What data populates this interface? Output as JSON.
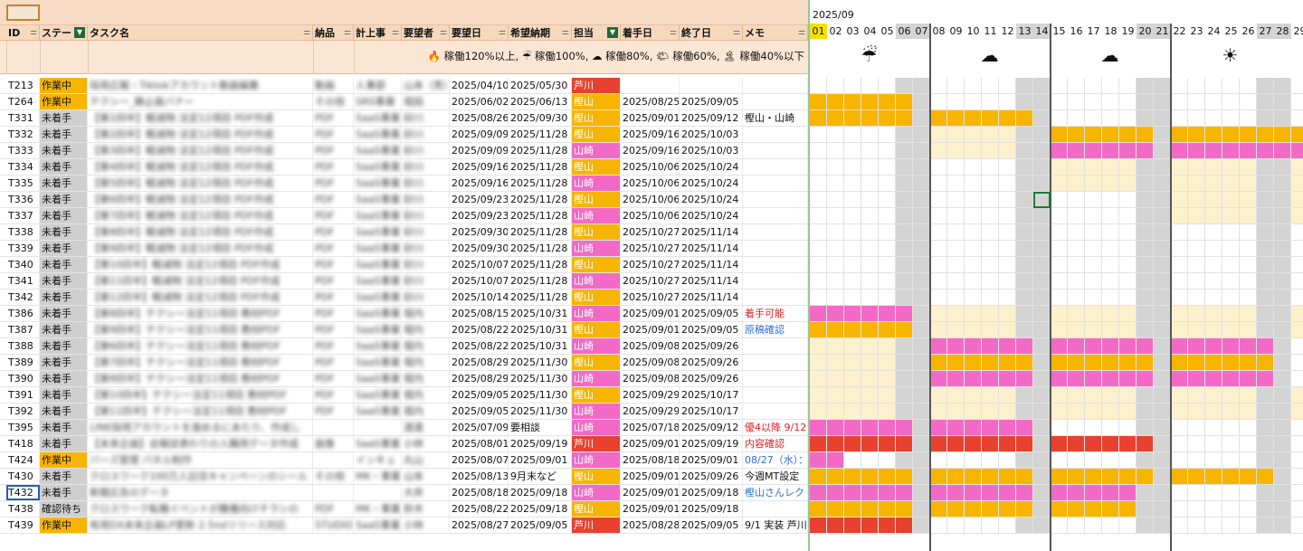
{
  "columns": [
    {
      "key": "id",
      "label": "ID",
      "filter": "plain"
    },
    {
      "key": "status",
      "label": "ステー",
      "filter": "active"
    },
    {
      "key": "task",
      "label": "タスク名",
      "filter": "plain"
    },
    {
      "key": "deliv",
      "label": "納品",
      "filter": "plain"
    },
    {
      "key": "acct",
      "label": "計上事",
      "filter": "plain"
    },
    {
      "key": "req",
      "label": "要望者",
      "filter": "plain"
    },
    {
      "key": "reqdate",
      "label": "要望日",
      "filter": "plain"
    },
    {
      "key": "due",
      "label": "希望納期",
      "filter": "plain"
    },
    {
      "key": "owner",
      "label": "担当",
      "filter": "active"
    },
    {
      "key": "start",
      "label": "着手日",
      "filter": "plain"
    },
    {
      "key": "end",
      "label": "終了日",
      "filter": "plain"
    },
    {
      "key": "memo",
      "label": "メモ",
      "filter": "plain"
    }
  ],
  "legend": "🔥 稼働120%以上, ☔ 稼働100%, ☁ 稼働80%, 🌤 稼働60%, 🏝 稼働40%以下",
  "gantt": {
    "month": "2025/09",
    "days": [
      "01",
      "02",
      "03",
      "04",
      "05",
      "06",
      "07",
      "08",
      "09",
      "10",
      "11",
      "12",
      "13",
      "14",
      "15",
      "16",
      "17",
      "18",
      "19",
      "20",
      "21",
      "22",
      "23",
      "24",
      "25",
      "26",
      "27",
      "28",
      "29"
    ],
    "weekends": [
      "06",
      "07",
      "13",
      "14",
      "20",
      "21",
      "27",
      "28"
    ],
    "today": "01",
    "weather": [
      "☔",
      "☁",
      "☁",
      "☀"
    ]
  },
  "colors": {
    "orange": "#f7b500",
    "pink": "#f36ac6",
    "red": "#e8412f",
    "light": "#fdf0cc",
    "weekend": "#d4d4d4"
  },
  "rows": [
    {
      "id": "T213",
      "status": "作業中",
      "task": "採用広報・Tiktokアカウント動画編集",
      "deliv": "動画",
      "acct": "人事部",
      "req": "山本（秀）",
      "reqdate": "2025/04/10",
      "due": "2025/05/30",
      "owner": "芦川",
      "start": "",
      "end": "",
      "memo": "",
      "memo_color": ""
    },
    {
      "id": "T264",
      "status": "作業中",
      "task": "テクシー_静止画バナー",
      "deliv": "その他",
      "acct": "SRS事業",
      "req": "堀田",
      "reqdate": "2025/06/02",
      "due": "2025/06/13",
      "owner": "樫山",
      "start": "2025/08/25",
      "end": "2025/09/05",
      "memo": "",
      "memo_color": ""
    },
    {
      "id": "T331",
      "status": "未着手",
      "task": "【第1四半】軽減物 法定12項目 PDF作成",
      "deliv": "PDF",
      "acct": "SaaS事業",
      "req": "砂川",
      "reqdate": "2025/08/26",
      "due": "2025/09/30",
      "owner": "樫山",
      "start": "2025/09/01",
      "end": "2025/09/12",
      "memo": "樫山・山崎",
      "memo_color": ""
    },
    {
      "id": "T332",
      "status": "未着手",
      "task": "【第2四半】軽減物 法定12項目 PDF作成",
      "deliv": "PDF",
      "acct": "SaaS事業",
      "req": "砂川",
      "reqdate": "2025/09/09",
      "due": "2025/11/28",
      "owner": "樫山",
      "start": "2025/09/16",
      "end": "2025/10/03",
      "memo": "",
      "memo_color": ""
    },
    {
      "id": "T333",
      "status": "未着手",
      "task": "【第3四半】軽減物 法定12項目 PDF作成",
      "deliv": "PDF",
      "acct": "SaaS事業",
      "req": "砂川",
      "reqdate": "2025/09/09",
      "due": "2025/11/28",
      "owner": "山崎",
      "start": "2025/09/16",
      "end": "2025/10/03",
      "memo": "",
      "memo_color": ""
    },
    {
      "id": "T334",
      "status": "未着手",
      "task": "【第4四半】軽減物 法定12項目 PDF作成",
      "deliv": "PDF",
      "acct": "SaaS事業",
      "req": "砂川",
      "reqdate": "2025/09/16",
      "due": "2025/11/28",
      "owner": "樫山",
      "start": "2025/10/06",
      "end": "2025/10/24",
      "memo": "",
      "memo_color": ""
    },
    {
      "id": "T335",
      "status": "未着手",
      "task": "【第5四半】軽減物 法定12項目 PDF作成",
      "deliv": "PDF",
      "acct": "SaaS事業",
      "req": "砂川",
      "reqdate": "2025/09/16",
      "due": "2025/11/28",
      "owner": "山崎",
      "start": "2025/10/06",
      "end": "2025/10/24",
      "memo": "",
      "memo_color": ""
    },
    {
      "id": "T336",
      "status": "未着手",
      "task": "【第6四半】軽減物 法定12項目 PDF作成",
      "deliv": "PDF",
      "acct": "SaaS事業",
      "req": "砂川",
      "reqdate": "2025/09/23",
      "due": "2025/11/28",
      "owner": "樫山",
      "start": "2025/10/06",
      "end": "2025/10/24",
      "memo": "",
      "memo_color": ""
    },
    {
      "id": "T337",
      "status": "未着手",
      "task": "【第7四半】軽減物 法定12項目 PDF作成",
      "deliv": "PDF",
      "acct": "SaaS事業",
      "req": "砂川",
      "reqdate": "2025/09/23",
      "due": "2025/11/28",
      "owner": "山崎",
      "start": "2025/10/06",
      "end": "2025/10/24",
      "memo": "",
      "memo_color": ""
    },
    {
      "id": "T338",
      "status": "未着手",
      "task": "【第8四半】軽減物 法定12項目 PDF作成",
      "deliv": "PDF",
      "acct": "SaaS事業",
      "req": "砂川",
      "reqdate": "2025/09/30",
      "due": "2025/11/28",
      "owner": "樫山",
      "start": "2025/10/27",
      "end": "2025/11/14",
      "memo": "",
      "memo_color": ""
    },
    {
      "id": "T339",
      "status": "未着手",
      "task": "【第9四半】軽減物 法定12項目 PDF作成",
      "deliv": "PDF",
      "acct": "SaaS事業",
      "req": "砂川",
      "reqdate": "2025/09/30",
      "due": "2025/11/28",
      "owner": "山崎",
      "start": "2025/10/27",
      "end": "2025/11/14",
      "memo": "",
      "memo_color": ""
    },
    {
      "id": "T340",
      "status": "未着手",
      "task": "【第10四半】軽減物 法定12項目 PDF作成",
      "deliv": "PDF",
      "acct": "SaaS事業",
      "req": "砂川",
      "reqdate": "2025/10/07",
      "due": "2025/11/28",
      "owner": "樫山",
      "start": "2025/10/27",
      "end": "2025/11/14",
      "memo": "",
      "memo_color": ""
    },
    {
      "id": "T341",
      "status": "未着手",
      "task": "【第11四半】軽減物 法定12項目 PDF作成",
      "deliv": "PDF",
      "acct": "SaaS事業",
      "req": "砂川",
      "reqdate": "2025/10/07",
      "due": "2025/11/28",
      "owner": "山崎",
      "start": "2025/10/27",
      "end": "2025/11/14",
      "memo": "",
      "memo_color": ""
    },
    {
      "id": "T342",
      "status": "未着手",
      "task": "【第12四半】軽減物 法定12項目 PDF作成",
      "deliv": "PDF",
      "acct": "SaaS事業",
      "req": "砂川",
      "reqdate": "2025/10/14",
      "due": "2025/11/28",
      "owner": "樫山",
      "start": "2025/10/27",
      "end": "2025/11/14",
      "memo": "",
      "memo_color": ""
    },
    {
      "id": "T386",
      "status": "未着手",
      "task": "【第8四半】テクシー法定11項目 教材PDF",
      "deliv": "PDF",
      "acct": "SaaS事業",
      "req": "堀内",
      "reqdate": "2025/08/15",
      "due": "2025/10/31",
      "owner": "山崎",
      "start": "2025/09/01",
      "end": "2025/09/05",
      "memo": "着手可能",
      "memo_color": "#e02020"
    },
    {
      "id": "T387",
      "status": "未着手",
      "task": "【第9四半】テクシー法定11項目 教材PDF",
      "deliv": "PDF",
      "acct": "SaaS事業",
      "req": "堀内",
      "reqdate": "2025/08/22",
      "due": "2025/10/31",
      "owner": "樫山",
      "start": "2025/09/01",
      "end": "2025/09/05",
      "memo": "原稿確認",
      "memo_color": "#2f6fd8"
    },
    {
      "id": "T388",
      "status": "未着手",
      "task": "【第6四半】テクシー法定11項目 教材PDF",
      "deliv": "PDF",
      "acct": "SaaS事業",
      "req": "堀内",
      "reqdate": "2025/08/22",
      "due": "2025/10/31",
      "owner": "山崎",
      "start": "2025/09/08",
      "end": "2025/09/26",
      "memo": "",
      "memo_color": ""
    },
    {
      "id": "T389",
      "status": "未着手",
      "task": "【第7四半】テクシー法定11項目 教材PDF",
      "deliv": "PDF",
      "acct": "SaaS事業",
      "req": "堀内",
      "reqdate": "2025/08/29",
      "due": "2025/11/30",
      "owner": "樫山",
      "start": "2025/09/08",
      "end": "2025/09/26",
      "memo": "",
      "memo_color": ""
    },
    {
      "id": "T390",
      "status": "未着手",
      "task": "【第8四半】テクシー法定11項目 教材PDF",
      "deliv": "PDF",
      "acct": "SaaS事業",
      "req": "堀内",
      "reqdate": "2025/08/29",
      "due": "2025/11/30",
      "owner": "山崎",
      "start": "2025/09/08",
      "end": "2025/09/26",
      "memo": "",
      "memo_color": ""
    },
    {
      "id": "T391",
      "status": "未着手",
      "task": "【第10四半】テクシー法定11項目 教材PDF",
      "deliv": "PDF",
      "acct": "SaaS事業",
      "req": "堀内",
      "reqdate": "2025/09/05",
      "due": "2025/11/30",
      "owner": "樫山",
      "start": "2025/09/29",
      "end": "2025/10/17",
      "memo": "",
      "memo_color": ""
    },
    {
      "id": "T392",
      "status": "未着手",
      "task": "【第11四半】テクシー法定11項目 教材PDF",
      "deliv": "PDF",
      "acct": "SaaS事業",
      "req": "堀内",
      "reqdate": "2025/09/05",
      "due": "2025/11/30",
      "owner": "山崎",
      "start": "2025/09/29",
      "end": "2025/10/17",
      "memo": "",
      "memo_color": ""
    },
    {
      "id": "T395",
      "status": "未着手",
      "task": "LINE採用アカウントを進めるにあたり、作成し",
      "deliv": "",
      "acct": "",
      "req": "渡邊",
      "reqdate": "2025/07/09",
      "due": "要相談",
      "owner": "山崎",
      "start": "2025/07/18",
      "end": "2025/09/12",
      "memo": "優4以降 9/12",
      "memo_color": "#e02020"
    },
    {
      "id": "T418",
      "status": "未着手",
      "task": "【未来企画】会報誌表わりの入職用データ作成",
      "deliv": "画像",
      "acct": "SaaS事業",
      "req": "小林",
      "reqdate": "2025/08/01",
      "due": "2025/09/19",
      "owner": "芦川",
      "start": "2025/09/01",
      "end": "2025/09/19",
      "memo": "内容確認",
      "memo_color": "#e02020"
    },
    {
      "id": "T424",
      "status": "作業中",
      "task": "バーズ管理 パネル制作",
      "deliv": "",
      "acct": "インキュ",
      "req": "丸山",
      "reqdate": "2025/08/07",
      "due": "2025/09/01",
      "owner": "山崎",
      "start": "2025/08/18",
      "end": "2025/09/01",
      "memo": "08/27（水）：",
      "memo_color": "#2f6fd8"
    },
    {
      "id": "T430",
      "status": "未着手",
      "task": "クロスワーク100万人記念キャンペーンのシール",
      "deliv": "その他",
      "acct": "MK・事業",
      "req": "山本",
      "reqdate": "2025/08/13",
      "due": "9月末など",
      "owner": "樫山",
      "start": "2025/09/01",
      "end": "2025/09/26",
      "memo": "今週MT設定",
      "memo_color": "#111111"
    },
    {
      "id": "T432",
      "status": "未着手",
      "task": "新聞広告のデータ",
      "deliv": "",
      "acct": "",
      "req": "大井",
      "reqdate": "2025/08/18",
      "due": "2025/09/18",
      "owner": "山崎",
      "start": "2025/09/01",
      "end": "2025/09/18",
      "memo": "樫山さんレク",
      "memo_color": "#2f6fd8"
    },
    {
      "id": "T438",
      "status": "確認待ち",
      "task": "クロスワーク転職イベントが難儀向けチラシの",
      "deliv": "PDF",
      "acct": "MK・事業",
      "req": "鈴木",
      "reqdate": "2025/08/22",
      "due": "2025/09/18",
      "owner": "樫山",
      "start": "2025/09/01",
      "end": "2025/09/18",
      "memo": "",
      "memo_color": ""
    },
    {
      "id": "T439",
      "status": "作業中",
      "task": "有用DX未来企画LP更新 2.5ndリリース対応",
      "deliv": "STUDIO",
      "acct": "SaaS事業",
      "req": "小林",
      "reqdate": "2025/08/27",
      "due": "2025/09/05",
      "owner": "芦川",
      "start": "2025/08/28",
      "end": "2025/09/05",
      "memo": "9/1 実装 芦川",
      "memo_color": "#111111"
    }
  ],
  "bars": [
    [],
    [
      [
        "o",
        0,
        5
      ]
    ],
    [
      [
        "o",
        0,
        5
      ],
      [
        "o",
        7,
        12
      ]
    ],
    [
      [
        "l",
        7,
        12
      ],
      [
        "l",
        14,
        28
      ],
      [
        "o",
        14,
        19
      ],
      [
        "o",
        21,
        28
      ]
    ],
    [
      [
        "l",
        7,
        12
      ],
      [
        "p",
        14,
        19
      ],
      [
        "p",
        21,
        28
      ]
    ],
    [
      [
        "l",
        14,
        28
      ]
    ],
    [
      [
        "l",
        14,
        28
      ]
    ],
    [
      [
        "l",
        21,
        28
      ]
    ],
    [
      [
        "l",
        21,
        28
      ]
    ],
    [],
    [],
    [],
    [],
    [],
    [
      [
        "p",
        0,
        5
      ],
      [
        "l",
        7,
        28
      ]
    ],
    [
      [
        "o",
        0,
        5
      ],
      [
        "l",
        7,
        28
      ]
    ],
    [
      [
        "l",
        0,
        5
      ],
      [
        "p",
        7,
        12
      ],
      [
        "p",
        14,
        19
      ],
      [
        "p",
        21,
        26
      ]
    ],
    [
      [
        "l",
        0,
        5
      ],
      [
        "o",
        7,
        12
      ],
      [
        "o",
        14,
        19
      ],
      [
        "o",
        21,
        26
      ]
    ],
    [
      [
        "l",
        0,
        5
      ],
      [
        "p",
        7,
        12
      ],
      [
        "p",
        14,
        19
      ],
      [
        "p",
        21,
        26
      ]
    ],
    [
      [
        "l",
        0,
        4
      ],
      [
        "l",
        7,
        12
      ],
      [
        "l",
        14,
        19
      ],
      [
        "l",
        21,
        28
      ]
    ],
    [
      [
        "l",
        0,
        4
      ],
      [
        "l",
        7,
        12
      ],
      [
        "l",
        14,
        19
      ],
      [
        "l",
        21,
        28
      ]
    ],
    [
      [
        "p",
        0,
        5
      ],
      [
        "p",
        7,
        12
      ]
    ],
    [
      [
        "r",
        0,
        5
      ],
      [
        "r",
        7,
        12
      ],
      [
        "r",
        14,
        19
      ]
    ],
    [
      [
        "p",
        0,
        1
      ]
    ],
    [
      [
        "o",
        0,
        5
      ],
      [
        "o",
        7,
        12
      ],
      [
        "o",
        14,
        19
      ],
      [
        "o",
        21,
        26
      ]
    ],
    [
      [
        "p",
        0,
        5
      ],
      [
        "p",
        7,
        12
      ],
      [
        "p",
        14,
        18
      ]
    ],
    [
      [
        "o",
        0,
        5
      ],
      [
        "o",
        7,
        12
      ],
      [
        "o",
        14,
        18
      ]
    ],
    [
      [
        "r",
        0,
        5
      ]
    ]
  ]
}
